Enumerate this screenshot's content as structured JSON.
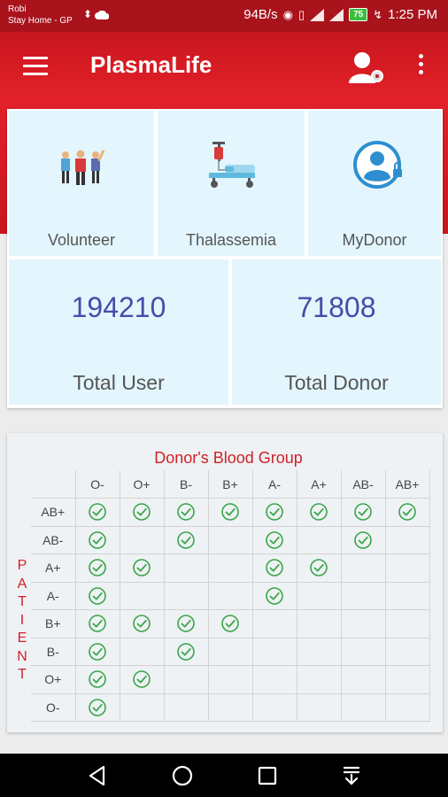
{
  "status_bar": {
    "carrier": "Robi",
    "network_name": "Stay Home - GP",
    "speed": "94B/s",
    "battery": "75",
    "time": "1:25 PM"
  },
  "app_bar": {
    "title": "PlasmaLife",
    "menu_icon": "hamburger-menu-icon",
    "profile_icon": "user-settings-icon",
    "more_icon": "more-vertical-icon"
  },
  "dashboard": {
    "tiles": [
      {
        "label": "Volunteer",
        "icon": "volunteers-icon"
      },
      {
        "label": "Thalassemia",
        "icon": "blood-transfusion-icon"
      },
      {
        "label": "MyDonor",
        "icon": "locked-user-icon"
      }
    ],
    "stats": [
      {
        "value": "194210",
        "label": "Total User"
      },
      {
        "value": "71808",
        "label": "Total Donor"
      }
    ]
  },
  "compatibility": {
    "title": "Donor's Blood Group",
    "patient_label": [
      "P",
      "A",
      "T",
      "I",
      "E",
      "N",
      "T"
    ],
    "donor_groups": [
      "O-",
      "O+",
      "B-",
      "B+",
      "A-",
      "A+",
      "AB-",
      "AB+"
    ],
    "patient_groups": [
      "AB+",
      "AB-",
      "A+",
      "A-",
      "B+",
      "B-",
      "O+",
      "O-"
    ],
    "matrix": [
      [
        1,
        1,
        1,
        1,
        1,
        1,
        1,
        1
      ],
      [
        1,
        0,
        1,
        0,
        1,
        0,
        1,
        0
      ],
      [
        1,
        1,
        0,
        0,
        1,
        1,
        0,
        0
      ],
      [
        1,
        0,
        0,
        0,
        1,
        0,
        0,
        0
      ],
      [
        1,
        1,
        1,
        1,
        0,
        0,
        0,
        0
      ],
      [
        1,
        0,
        1,
        0,
        0,
        0,
        0,
        0
      ],
      [
        1,
        1,
        0,
        0,
        0,
        0,
        0,
        0
      ],
      [
        1,
        0,
        0,
        0,
        0,
        0,
        0,
        0
      ]
    ],
    "check_color": "#3aa64a"
  },
  "nav_bar": {
    "back_icon": "back-triangle-icon",
    "home_icon": "home-circle-icon",
    "recents_icon": "recents-square-icon",
    "notifications_icon": "pull-down-icon"
  },
  "colors": {
    "primary": "#d91c24",
    "tile_bg": "#e3f6fd",
    "stat_value": "#4a4aa8"
  }
}
